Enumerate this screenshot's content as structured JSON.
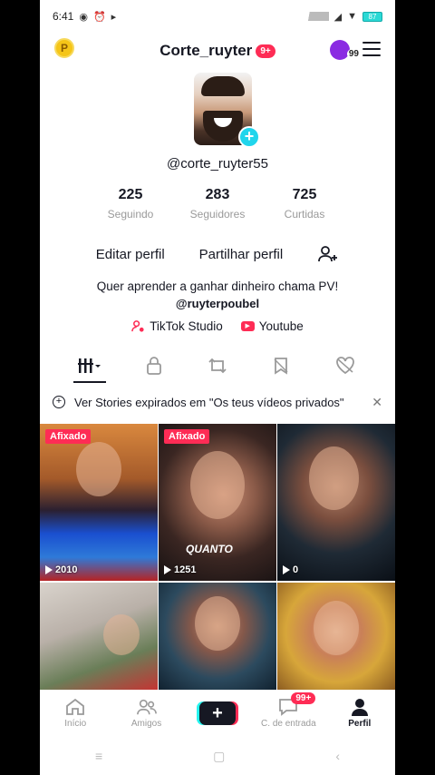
{
  "status_bar": {
    "time": "6:41",
    "battery": "87"
  },
  "header": {
    "username": "Corte_ruyter",
    "notif_badge": "9+",
    "coin_letter": "P",
    "avatar_count": "99"
  },
  "profile": {
    "handle": "@corte_ruyter55",
    "stats": [
      {
        "value": "225",
        "label": "Seguindo"
      },
      {
        "value": "283",
        "label": "Seguidores"
      },
      {
        "value": "725",
        "label": "Curtidas"
      }
    ],
    "edit_label": "Editar perfil",
    "share_label": "Partilhar perfil",
    "bio": "Quer aprender a ganhar dinheiro chama PV!",
    "bio_mention": "@ruyterpoubel",
    "links": [
      {
        "label": "TikTok Studio",
        "icon": "tiktok-studio-icon"
      },
      {
        "label": "Youtube",
        "icon": "youtube-icon"
      }
    ]
  },
  "tabs": [
    "videos-grid-icon",
    "lock-icon",
    "repost-icon",
    "bookmark-icon",
    "liked-heart-icon"
  ],
  "notice": {
    "text": "Ver Stories expirados em \"Os teus vídeos privados\""
  },
  "videos": [
    {
      "pinned": "Afixado",
      "views": "2010"
    },
    {
      "pinned": "Afixado",
      "views": "1251",
      "caption": "QUANTO"
    },
    {
      "pinned": "",
      "views": "0"
    },
    {
      "pinned": "",
      "views": ""
    },
    {
      "pinned": "",
      "views": ""
    },
    {
      "pinned": "",
      "views": ""
    }
  ],
  "bottom_nav": {
    "home": "Início",
    "friends": "Amigos",
    "create": "+",
    "inbox": "C. de entrada",
    "inbox_badge": "99+",
    "profile": "Perfil"
  },
  "colors": {
    "accent": "#fe2c55",
    "cyan": "#25f4ee",
    "text": "#161823",
    "muted": "#9a9a9a"
  }
}
